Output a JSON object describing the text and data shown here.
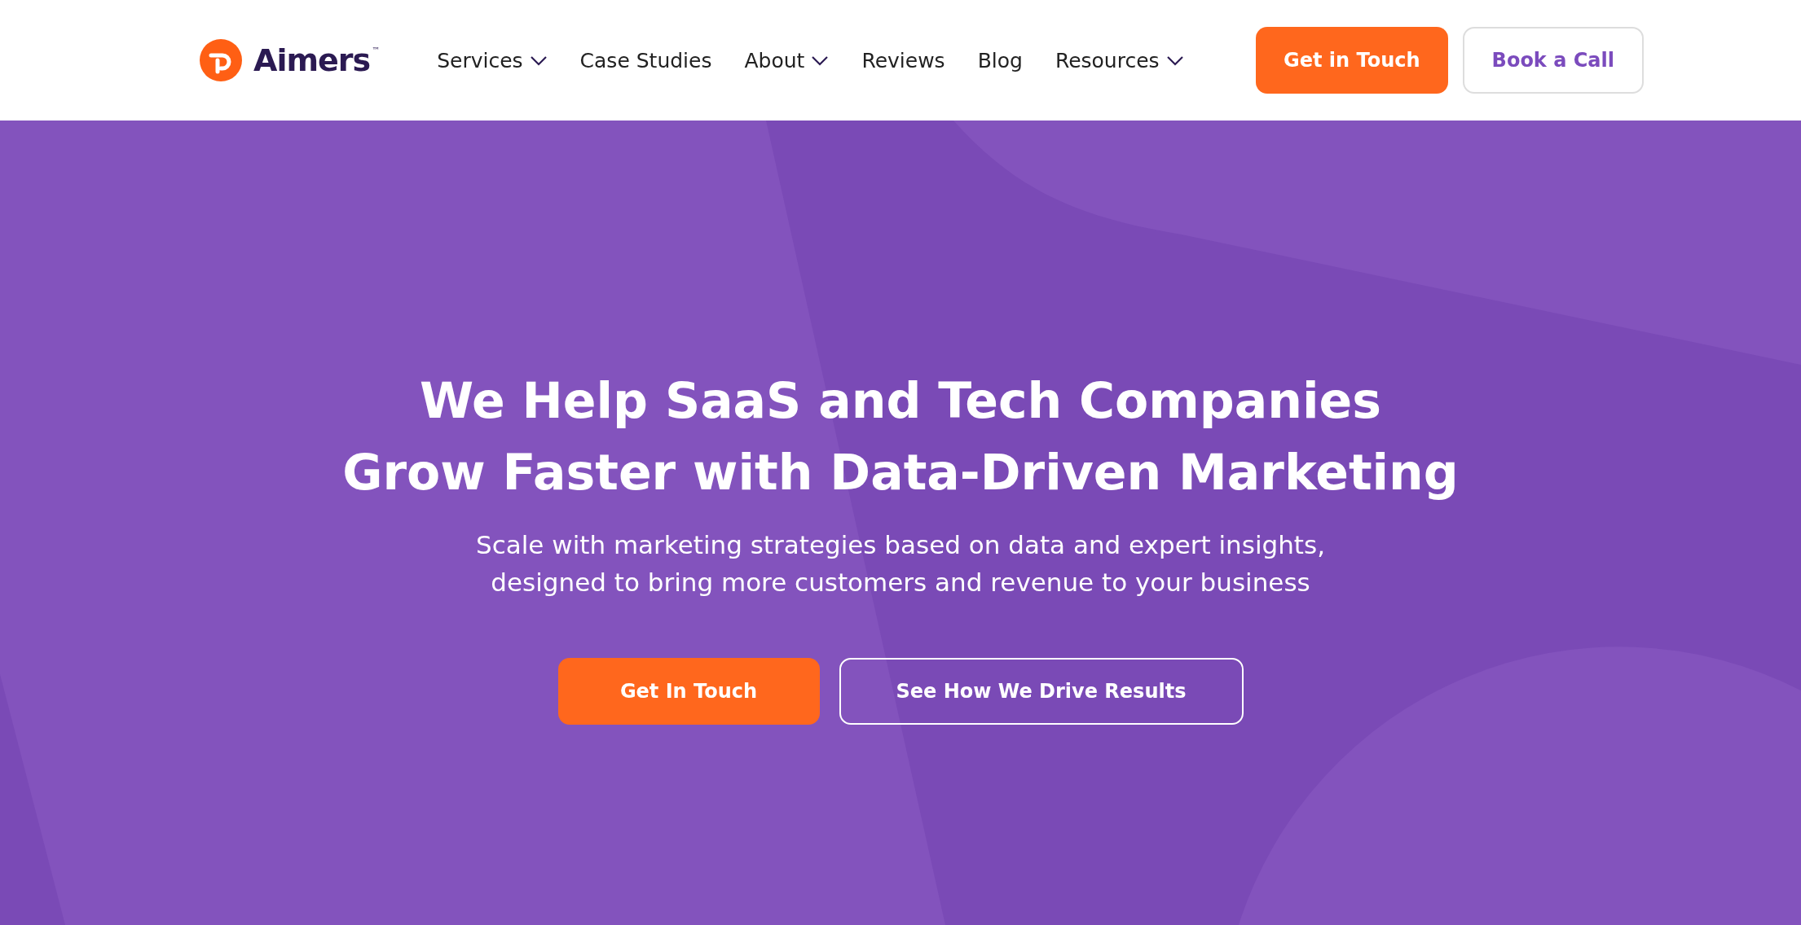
{
  "header": {
    "logo": {
      "name": "Aimers",
      "trademark": "™"
    },
    "nav": [
      {
        "label": "Services",
        "dropdown": true
      },
      {
        "label": "Case Studies",
        "dropdown": false
      },
      {
        "label": "About",
        "dropdown": true
      },
      {
        "label": "Reviews",
        "dropdown": false
      },
      {
        "label": "Blog",
        "dropdown": false
      },
      {
        "label": "Resources",
        "dropdown": true
      }
    ],
    "buttons": [
      {
        "label": "Get in Touch",
        "kind": "primary"
      },
      {
        "label": "Book a Call",
        "kind": "outline"
      }
    ]
  },
  "hero": {
    "heading_lines": [
      "We Help SaaS and Tech Companies",
      "Grow Faster with Data-Driven Marketing"
    ],
    "subtitle_lines": [
      "Scale with marketing strategies based on data and expert insights,",
      "designed to bring more customers and revenue to your business"
    ],
    "buttons": [
      {
        "label": "Get In Touch",
        "kind": "primary"
      },
      {
        "label": "See How We Drive Results",
        "kind": "outline"
      }
    ]
  }
}
